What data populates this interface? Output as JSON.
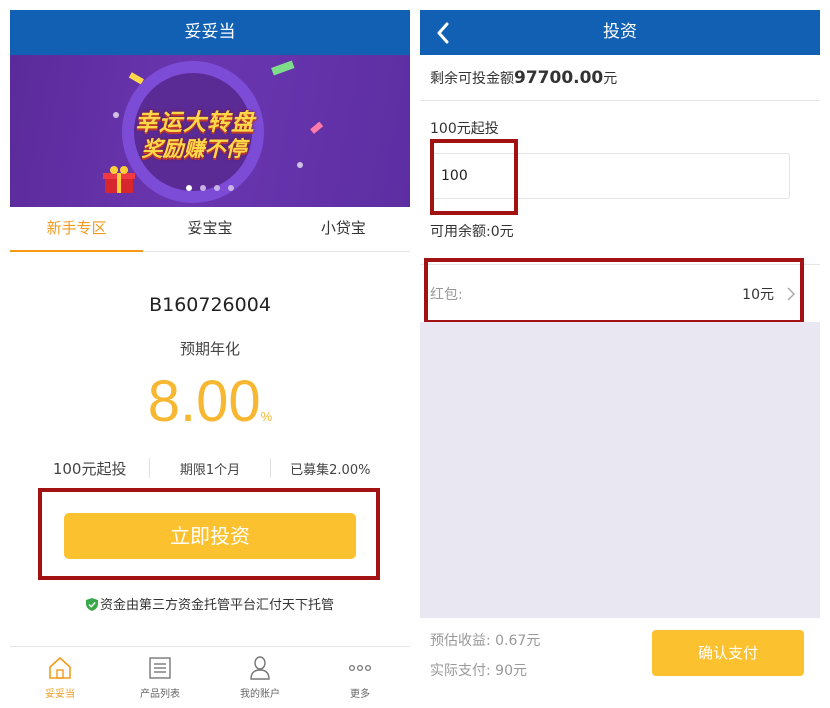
{
  "left": {
    "title": "妥妥当",
    "banner": {
      "line1": "幸运大转盘",
      "line2": "奖励赚不停"
    },
    "tabs": [
      {
        "label": "新手专区",
        "active": true
      },
      {
        "label": "妥宝宝",
        "active": false
      },
      {
        "label": "小贷宝",
        "active": false
      }
    ],
    "product_code": "B160726004",
    "rate_label": "预期年化",
    "rate_value": "8.00",
    "rate_unit": "%",
    "stats": {
      "min_invest": "100元起投",
      "term": "期限1个月",
      "raised": "已募集2.00%"
    },
    "invest_button": "立即投资",
    "trust_note": "资金由第三方资金托管平台汇付天下托管",
    "bottom_nav": [
      {
        "label": "妥妥当",
        "icon": "home-icon",
        "active": true
      },
      {
        "label": "产品列表",
        "icon": "list-icon",
        "active": false
      },
      {
        "label": "我的账户",
        "icon": "user-icon",
        "active": false
      },
      {
        "label": "更多",
        "icon": "more-icon",
        "active": false
      }
    ]
  },
  "right": {
    "title": "投资",
    "remaining_label": "剩余可投金额",
    "remaining_amount": "97700.00",
    "remaining_unit": "元",
    "min_label": "100元起投",
    "amount_input_value": "100",
    "balance": "可用余额:0元",
    "redpacket_label": "红包:",
    "redpacket_value": "10元",
    "est_income": "预估收益: 0.67元",
    "actual_pay": "实际支付: 90元",
    "confirm_button": "确认支付"
  },
  "colors": {
    "nav_blue": "#1160b3",
    "accent_orange": "#f39a1c",
    "button_yellow": "#fcc12e",
    "highlight_red": "#a31212"
  }
}
